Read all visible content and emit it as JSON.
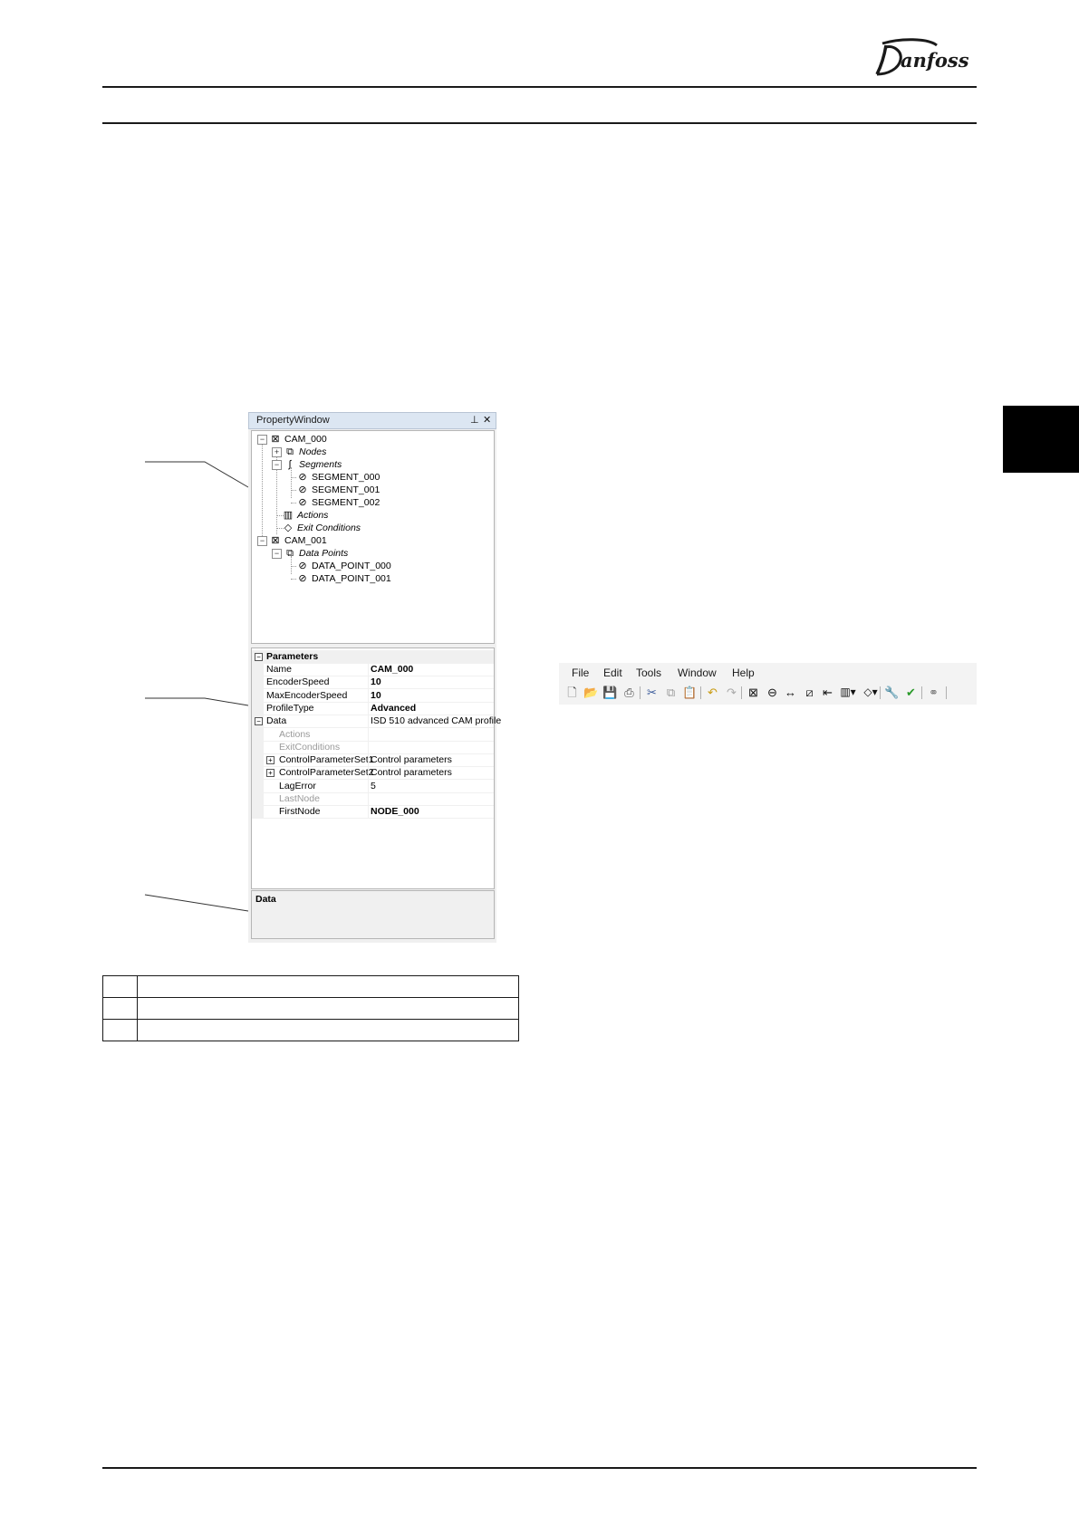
{
  "brand": {
    "logo_text": "Danfoss",
    "logo_color": "#1a1a1a"
  },
  "property_window": {
    "title": "PropertyWindow",
    "pin_icon": "pin-icon",
    "close_icon": "close-icon",
    "tree": [
      {
        "label": "CAM_000",
        "icon": "cam-icon",
        "expander": "−",
        "italic": false
      },
      {
        "label": "Nodes",
        "icon": "nodes-icon",
        "expander": "+",
        "italic": true
      },
      {
        "label": "Segments",
        "icon": "segments-icon",
        "expander": "−",
        "italic": true
      },
      {
        "label": "SEGMENT_000",
        "icon": "no-entry-icon",
        "italic": false
      },
      {
        "label": "SEGMENT_001",
        "icon": "no-entry-icon",
        "italic": false
      },
      {
        "label": "SEGMENT_002",
        "icon": "no-entry-icon",
        "italic": false
      },
      {
        "label": "Actions",
        "icon": "actions-icon",
        "italic": true
      },
      {
        "label": "Exit Conditions",
        "icon": "diamond-icon",
        "italic": true
      },
      {
        "label": "CAM_001",
        "icon": "cam-icon",
        "expander": "−",
        "italic": false
      },
      {
        "label": "Data Points",
        "icon": "nodes-icon",
        "expander": "−",
        "italic": true
      },
      {
        "label": "DATA_POINT_000",
        "icon": "no-entry-icon",
        "italic": false
      },
      {
        "label": "DATA_POINT_001",
        "icon": "no-entry-icon",
        "italic": false
      }
    ],
    "grid": {
      "category": "Parameters",
      "rows": [
        {
          "key": "Name",
          "value": "CAM_000"
        },
        {
          "key": "EncoderSpeed",
          "value": "10"
        },
        {
          "key": "MaxEncoderSpeed",
          "value": "10"
        },
        {
          "key": "ProfileType",
          "value": "Advanced"
        },
        {
          "key": "Data",
          "value": "ISD 510 advanced CAM profile"
        },
        {
          "key": "Actions",
          "value": ""
        },
        {
          "key": "ExitConditions",
          "value": ""
        },
        {
          "key": "ControlParameterSet1",
          "value": "Control parameters"
        },
        {
          "key": "ControlParameterSet2",
          "value": "Control parameters"
        },
        {
          "key": "LagError",
          "value": "5"
        },
        {
          "key": "LastNode",
          "value": ""
        },
        {
          "key": "FirstNode",
          "value": "NODE_000"
        }
      ]
    },
    "description": {
      "title": "Data"
    }
  },
  "caption_table": [
    {
      "num": "",
      "text": ""
    },
    {
      "num": "",
      "text": ""
    },
    {
      "num": "",
      "text": ""
    }
  ],
  "toolbar": {
    "menus": [
      "File",
      "Edit",
      "Tools",
      "Window",
      "Help"
    ],
    "buttons": [
      "new-file-icon",
      "open-folder-icon",
      "save-icon",
      "print-icon",
      "cut-icon",
      "copy-icon",
      "paste-icon",
      "undo-icon",
      "redo-icon",
      "cam-icon",
      "circle-minus-icon",
      "double-arrow-icon",
      "slash-box-icon",
      "arrow-left-bar-icon",
      "columns-dropdown-icon",
      "diamond-dropdown-icon",
      "wrench-icon",
      "checkmark-icon",
      "link-icon"
    ]
  }
}
